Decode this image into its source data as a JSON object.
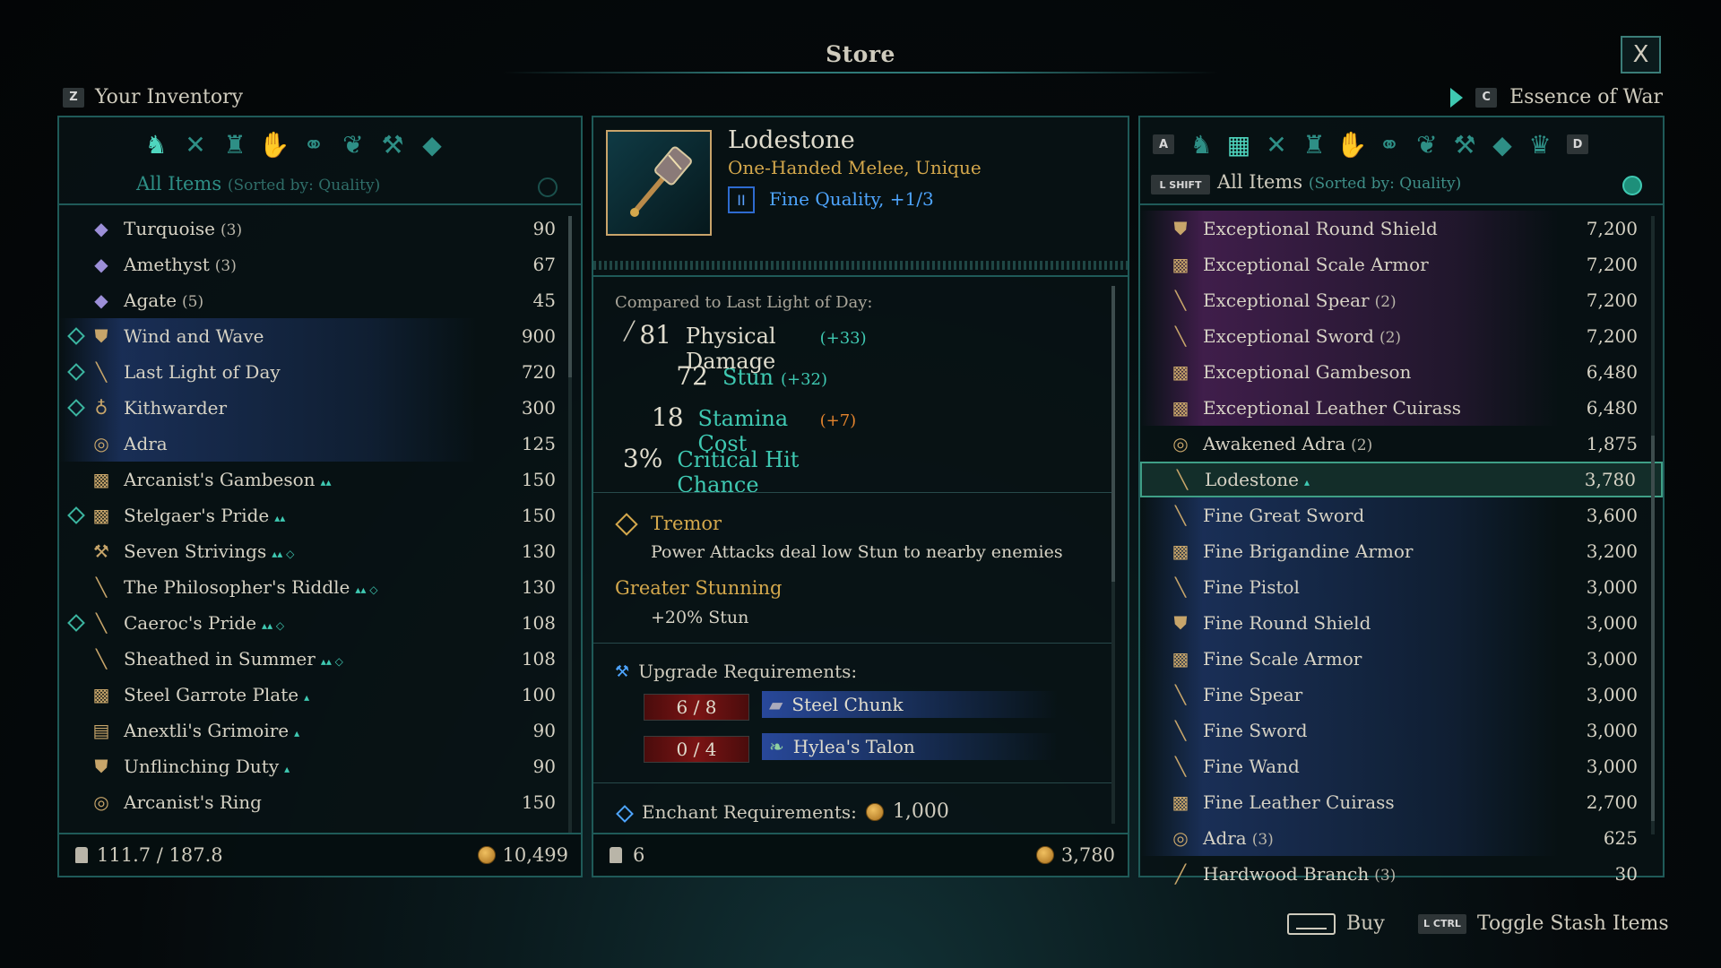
{
  "header": {
    "title": "Store",
    "close_label": "X"
  },
  "inventory": {
    "key": "Z",
    "label": "Your Inventory",
    "sort_label": "All Items",
    "sort_note": "(Sorted by: Quality)",
    "filters": [
      "bag-icon",
      "crossed-weapons-icon",
      "armor-icon",
      "gauntlet-icon",
      "rings-icon",
      "gem-flask-icon",
      "anvil-icon",
      "diamond-icon"
    ],
    "items": [
      {
        "diamond": false,
        "icon": "gem-icon",
        "glyph": "◆",
        "name": "Turquoise",
        "qty": "(3)",
        "value": "90",
        "hl": "",
        "badge": ""
      },
      {
        "diamond": false,
        "icon": "gem-icon",
        "glyph": "◆",
        "name": "Amethyst",
        "qty": "(3)",
        "value": "67",
        "hl": "",
        "badge": ""
      },
      {
        "diamond": false,
        "icon": "gem-icon",
        "glyph": "◆",
        "name": "Agate",
        "qty": "(5)",
        "value": "45",
        "hl": "",
        "badge": ""
      },
      {
        "diamond": true,
        "icon": "shield-icon",
        "glyph": "⛊",
        "name": "Wind and Wave",
        "qty": "",
        "value": "900",
        "hl": "blue",
        "badge": ""
      },
      {
        "diamond": true,
        "icon": "sword-icon",
        "glyph": "╲",
        "name": "Last Light of Day",
        "qty": "",
        "value": "720",
        "hl": "blue",
        "badge": ""
      },
      {
        "diamond": true,
        "icon": "amulet-icon",
        "glyph": "♁",
        "name": "Kithwarder",
        "qty": "",
        "value": "300",
        "hl": "blue",
        "badge": ""
      },
      {
        "diamond": false,
        "icon": "ring-icon",
        "glyph": "◎",
        "name": "Adra",
        "qty": "",
        "value": "125",
        "hl": "blue",
        "badge": ""
      },
      {
        "diamond": false,
        "icon": "armor-icon",
        "glyph": "▩",
        "name": "Arcanist's Gambeson",
        "qty": "",
        "value": "150",
        "hl": "",
        "badge": "▴▴"
      },
      {
        "diamond": true,
        "icon": "armor-icon",
        "glyph": "▩",
        "name": "Stelgaer's Pride",
        "qty": "",
        "value": "150",
        "hl": "",
        "badge": "▴▴"
      },
      {
        "diamond": false,
        "icon": "hammer-icon",
        "glyph": "⚒",
        "name": "Seven Strivings",
        "qty": "",
        "value": "130",
        "hl": "",
        "badge": "▴▴ ◇"
      },
      {
        "diamond": false,
        "icon": "sword-icon",
        "glyph": "╲",
        "name": "The Philosopher's Riddle",
        "qty": "",
        "value": "130",
        "hl": "",
        "badge": "▴▴ ◇"
      },
      {
        "diamond": true,
        "icon": "pistol-icon",
        "glyph": "╲",
        "name": "Caeroc's Pride",
        "qty": "",
        "value": "108",
        "hl": "",
        "badge": "▴▴ ◇"
      },
      {
        "diamond": false,
        "icon": "dagger-icon",
        "glyph": "╲",
        "name": "Sheathed in Summer",
        "qty": "",
        "value": "108",
        "hl": "",
        "badge": "▴▴ ◇"
      },
      {
        "diamond": false,
        "icon": "armor-icon",
        "glyph": "▩",
        "name": "Steel Garrote Plate",
        "qty": "",
        "value": "100",
        "hl": "",
        "badge": "▴"
      },
      {
        "diamond": false,
        "icon": "grimoire-icon",
        "glyph": "▤",
        "name": "Anextli's Grimoire",
        "qty": "",
        "value": "90",
        "hl": "",
        "badge": "▴"
      },
      {
        "diamond": false,
        "icon": "shield-icon",
        "glyph": "⛊",
        "name": "Unflinching Duty",
        "qty": "",
        "value": "90",
        "hl": "",
        "badge": "▴"
      },
      {
        "diamond": false,
        "icon": "ring-icon",
        "glyph": "◎",
        "name": "Arcanist's Ring",
        "qty": "",
        "value": "150",
        "hl": "",
        "badge": ""
      }
    ],
    "weight": "111.7 / 187.8",
    "gold": "10,499"
  },
  "detail": {
    "name": "Lodestone",
    "type": "One-Handed Melee, Unique",
    "quality_numeral": "II",
    "quality": "Fine Quality, +1/3",
    "compared_to": "Compared to Last Light of Day:",
    "stats": [
      {
        "num": "81",
        "name": "Physical Damage",
        "delta": "(+33)",
        "dir": "pos",
        "light": true
      },
      {
        "num": "72",
        "name": "Stun",
        "delta": "(+32)",
        "dir": "pos",
        "light": false
      },
      {
        "num": "18",
        "name": "Stamina Cost",
        "delta": "(+7)",
        "dir": "neg",
        "light": false
      },
      {
        "num": "3%",
        "name": "Critical Hit Chance",
        "delta": "",
        "dir": "",
        "light": false
      }
    ],
    "trait_title": "Tremor",
    "trait_desc": "Power Attacks deal low Stun to nearby enemies",
    "trait2_title": "Greater Stunning",
    "trait2_desc": "+20% Stun",
    "upgrade_label": "Upgrade Requirements:",
    "upgrade_reqs": [
      {
        "count": "6 / 8",
        "name": "Steel Chunk"
      },
      {
        "count": "0 / 4",
        "name": "Hylea's Talon"
      }
    ],
    "enchant_label": "Enchant Requirements:",
    "enchant_cost": "1,000",
    "weight": "6",
    "price": "3,780"
  },
  "store": {
    "key": "C",
    "label": "Essence of War",
    "key_left": "A",
    "key_right": "D",
    "shift_key": "L SHIFT",
    "sort_label": "All Items",
    "sort_note": "(Sorted by: Quality)",
    "items": [
      {
        "icon": "shield-icon",
        "glyph": "⛊",
        "name": "Exceptional Round Shield",
        "qty": "",
        "value": "7,200",
        "hl": "purple",
        "badge": ""
      },
      {
        "icon": "armor-icon",
        "glyph": "▩",
        "name": "Exceptional Scale Armor",
        "qty": "",
        "value": "7,200",
        "hl": "purple",
        "badge": ""
      },
      {
        "icon": "spear-icon",
        "glyph": "╲",
        "name": "Exceptional Spear",
        "qty": "(2)",
        "value": "7,200",
        "hl": "purple",
        "badge": ""
      },
      {
        "icon": "sword-icon",
        "glyph": "╲",
        "name": "Exceptional Sword",
        "qty": "(2)",
        "value": "7,200",
        "hl": "purple",
        "badge": ""
      },
      {
        "icon": "armor-icon",
        "glyph": "▩",
        "name": "Exceptional Gambeson",
        "qty": "",
        "value": "6,480",
        "hl": "purple",
        "badge": ""
      },
      {
        "icon": "armor-icon",
        "glyph": "▩",
        "name": "Exceptional Leather Cuirass",
        "qty": "",
        "value": "6,480",
        "hl": "purple",
        "badge": ""
      },
      {
        "icon": "ring-icon",
        "glyph": "◎",
        "name": "Awakened Adra",
        "qty": "(2)",
        "value": "1,875",
        "hl": "",
        "badge": ""
      },
      {
        "icon": "hammer-icon",
        "glyph": "╲",
        "name": "Lodestone",
        "qty": "",
        "value": "3,780",
        "hl": "selected",
        "badge": "▴"
      },
      {
        "icon": "greatsword-icon",
        "glyph": "╲",
        "name": "Fine Great Sword",
        "qty": "",
        "value": "3,600",
        "hl": "blue",
        "badge": ""
      },
      {
        "icon": "armor-icon",
        "glyph": "▩",
        "name": "Fine Brigandine Armor",
        "qty": "",
        "value": "3,200",
        "hl": "blue",
        "badge": ""
      },
      {
        "icon": "pistol-icon",
        "glyph": "╲",
        "name": "Fine Pistol",
        "qty": "",
        "value": "3,000",
        "hl": "blue",
        "badge": ""
      },
      {
        "icon": "shield-icon",
        "glyph": "⛊",
        "name": "Fine Round Shield",
        "qty": "",
        "value": "3,000",
        "hl": "blue",
        "badge": ""
      },
      {
        "icon": "armor-icon",
        "glyph": "▩",
        "name": "Fine Scale Armor",
        "qty": "",
        "value": "3,000",
        "hl": "blue",
        "badge": ""
      },
      {
        "icon": "spear-icon",
        "glyph": "╲",
        "name": "Fine Spear",
        "qty": "",
        "value": "3,000",
        "hl": "blue",
        "badge": ""
      },
      {
        "icon": "sword-icon",
        "glyph": "╲",
        "name": "Fine Sword",
        "qty": "",
        "value": "3,000",
        "hl": "blue",
        "badge": ""
      },
      {
        "icon": "wand-icon",
        "glyph": "╲",
        "name": "Fine Wand",
        "qty": "",
        "value": "3,000",
        "hl": "blue",
        "badge": ""
      },
      {
        "icon": "armor-icon",
        "glyph": "▩",
        "name": "Fine Leather Cuirass",
        "qty": "",
        "value": "2,700",
        "hl": "blue",
        "badge": ""
      },
      {
        "icon": "ring-icon",
        "glyph": "◎",
        "name": "Adra",
        "qty": "(3)",
        "value": "625",
        "hl": "blue",
        "badge": ""
      },
      {
        "icon": "branch-icon",
        "glyph": "╱",
        "name": "Hardwood Branch",
        "qty": "(3)",
        "value": "30",
        "hl": "",
        "badge": ""
      }
    ]
  },
  "hints": {
    "buy_label": "Buy",
    "toggle_key": "L CTRL",
    "toggle_label": "Toggle Stash Items"
  }
}
